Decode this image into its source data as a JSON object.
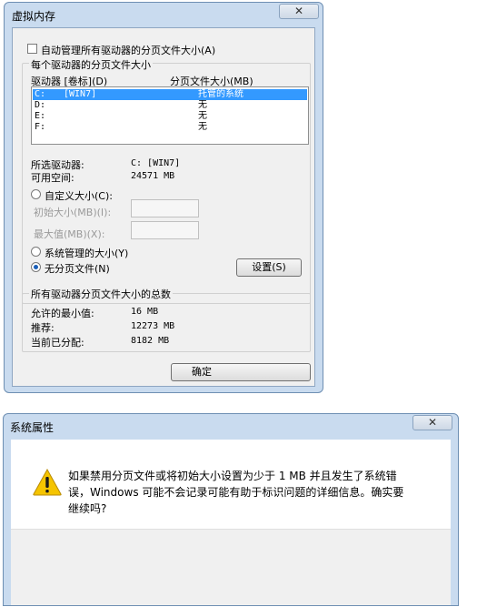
{
  "vm_dialog": {
    "title": "虚拟内存",
    "close_glyph": "✕",
    "auto_manage_label": "自动管理所有驱动器的分页文件大小(A)",
    "group_per_drive": "每个驱动器的分页文件大小",
    "col_drive": "驱动器 [卷标](D)",
    "col_size": "分页文件大小(MB)",
    "drives": [
      {
        "drive": "C:",
        "label": "[WIN7]",
        "size": "托管的系统",
        "selected": true
      },
      {
        "drive": "D:",
        "label": "",
        "size": "无",
        "selected": false
      },
      {
        "drive": "E:",
        "label": "",
        "size": "无",
        "selected": false
      },
      {
        "drive": "F:",
        "label": "",
        "size": "无",
        "selected": false
      }
    ],
    "selected_drive_label": "所选驱动器:",
    "selected_drive_value": "C:  [WIN7]",
    "free_space_label": "可用空间:",
    "free_space_value": "24571 MB",
    "custom_size_label": "自定义大小(C):",
    "initial_size_label": "初始大小(MB)(I):",
    "max_size_label": "最大值(MB)(X):",
    "system_managed_label": "系统管理的大小(Y)",
    "no_paging_label": "无分页文件(N)",
    "set_button": "设置(S)",
    "group_total": "所有驱动器分页文件大小的总数",
    "min_allowed_label": "允许的最小值:",
    "min_allowed_value": "16 MB",
    "recommended_label": "推荐:",
    "recommended_value": "12273 MB",
    "allocated_label": "当前已分配:",
    "allocated_value": "8182 MB",
    "ok_button": "确定",
    "selected_option": "no_paging_file"
  },
  "sys_dialog": {
    "title": "系统属性",
    "close_glyph": "✕",
    "message": "如果禁用分页文件或将初始大小设置为少于 1 MB 并且发生了系统错误，Windows 可能不会记录可能有助于标识问题的详细信息。确实要继续吗?",
    "icon": "warning-icon"
  },
  "colors": {
    "selection": "#3399ff",
    "frame": "#c9dbef",
    "warning": "#f5c400"
  }
}
